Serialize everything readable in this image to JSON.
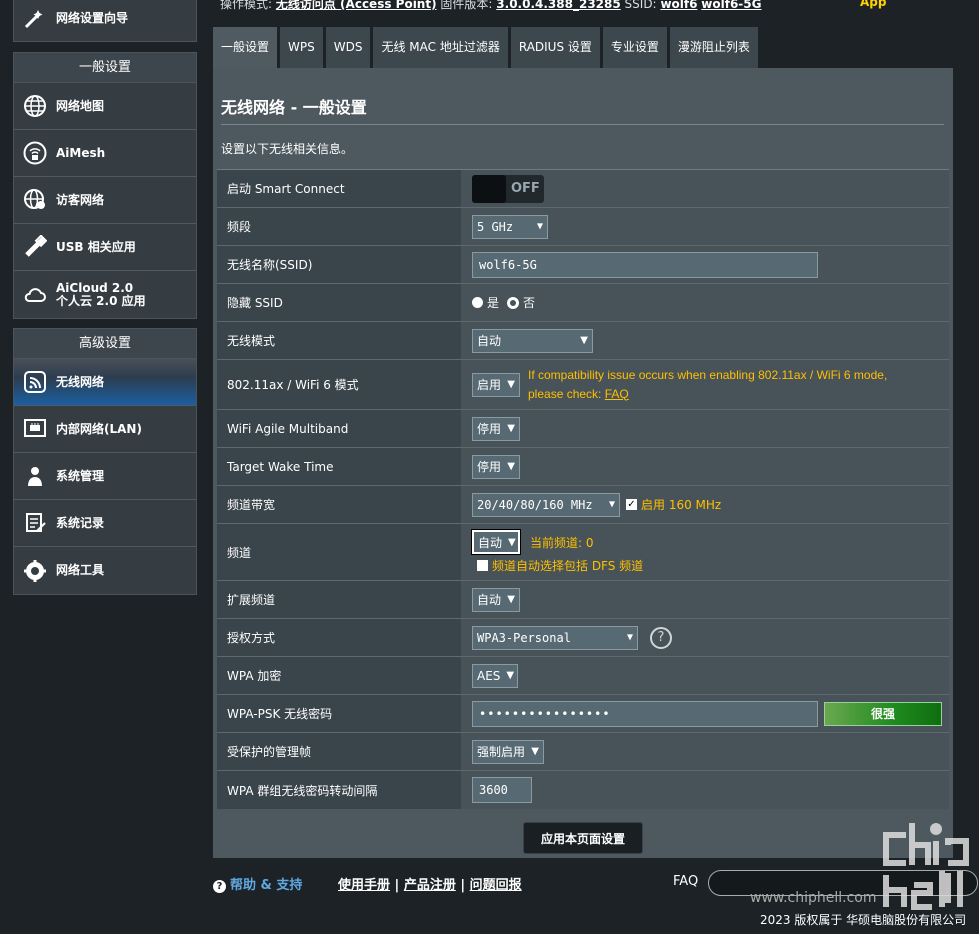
{
  "top": {
    "partial_text": "操作模式:",
    "mode": "无线访问点 (Access Point)",
    "fw_label": "固件版本:",
    "fw": "3.0.0.4.388_23285",
    "ssid_label": "SSID:",
    "ssid1": "wolf6",
    "ssid2": "wolf6-5G",
    "app": "App"
  },
  "sidebar": {
    "wizard": "网络设置向导",
    "general_header": "一般设置",
    "general_items": [
      {
        "label": "网络地图",
        "icon": "globe-network-icon"
      },
      {
        "label": "AiMesh",
        "icon": "aimesh-icon"
      },
      {
        "label": "访客网络",
        "icon": "guest-globe-icon"
      },
      {
        "label": "USB 相关应用",
        "icon": "usb-icon"
      },
      {
        "label": "AiCloud 2.0",
        "label2": "个人云 2.0 应用",
        "icon": "cloud-icon"
      }
    ],
    "advanced_header": "高级设置",
    "advanced_items": [
      {
        "label": "无线网络",
        "icon": "wifi-icon",
        "active": true
      },
      {
        "label": "内部网络(LAN)",
        "icon": "lan-icon"
      },
      {
        "label": "系统管理",
        "icon": "admin-icon"
      },
      {
        "label": "系统记录",
        "icon": "log-icon"
      },
      {
        "label": "网络工具",
        "icon": "tools-icon"
      }
    ]
  },
  "tabs": [
    "一般设置",
    "WPS",
    "WDS",
    "无线 MAC 地址过滤器",
    "RADIUS 设置",
    "专业设置",
    "漫游阻止列表"
  ],
  "main": {
    "title": "无线网络 - 一般设置",
    "desc": "设置以下无线相关信息。",
    "rows": {
      "smart_connect": {
        "label": "启动 Smart Connect",
        "value": "OFF"
      },
      "band": {
        "label": "频段",
        "value": "5 GHz"
      },
      "ssid": {
        "label": "无线名称(SSID)",
        "value": "wolf6-5G"
      },
      "hide_ssid": {
        "label": "隐藏 SSID",
        "yes": "是",
        "no": "否"
      },
      "mode": {
        "label": "无线模式",
        "value": "自动"
      },
      "ax": {
        "label": "802.11ax / WiFi 6 模式",
        "value": "启用",
        "note1": "If compatibility issue occurs when enabling 802.11ax / WiFi 6 mode,",
        "note2": "please check: ",
        "faq": "FAQ"
      },
      "agile": {
        "label": "WiFi Agile Multiband",
        "value": "停用"
      },
      "twt": {
        "label": "Target Wake Time",
        "value": "停用"
      },
      "bw": {
        "label": "频道带宽",
        "value": "20/40/80/160 MHz",
        "check": "启用 160 MHz"
      },
      "channel": {
        "label": "频道",
        "value": "自动",
        "current": "当前频道: 0",
        "dfs": "频道自动选择包括 DFS 频道"
      },
      "ext": {
        "label": "扩展频道",
        "value": "自动"
      },
      "auth": {
        "label": "授权方式",
        "value": "WPA3-Personal"
      },
      "wpa_enc": {
        "label": "WPA 加密",
        "value": "AES"
      },
      "psk": {
        "label": "WPA-PSK 无线密码",
        "value": "••••••••••••••••",
        "strength": "很强"
      },
      "pmf": {
        "label": "受保护的管理帧",
        "value": "强制启用"
      },
      "rekey": {
        "label": "WPA 群组无线密码转动间隔",
        "value": "3600"
      }
    },
    "apply": "应用本页面设置"
  },
  "footer": {
    "help": "帮助 & 支持",
    "manual": "使用手册",
    "reg": "产品注册",
    "feedback": "问题回报",
    "sep": " | ",
    "faq": "FAQ"
  },
  "watermark": "www.chiphell.com",
  "copyright": "2023 版权属于 华硕电脑股份有限公司"
}
